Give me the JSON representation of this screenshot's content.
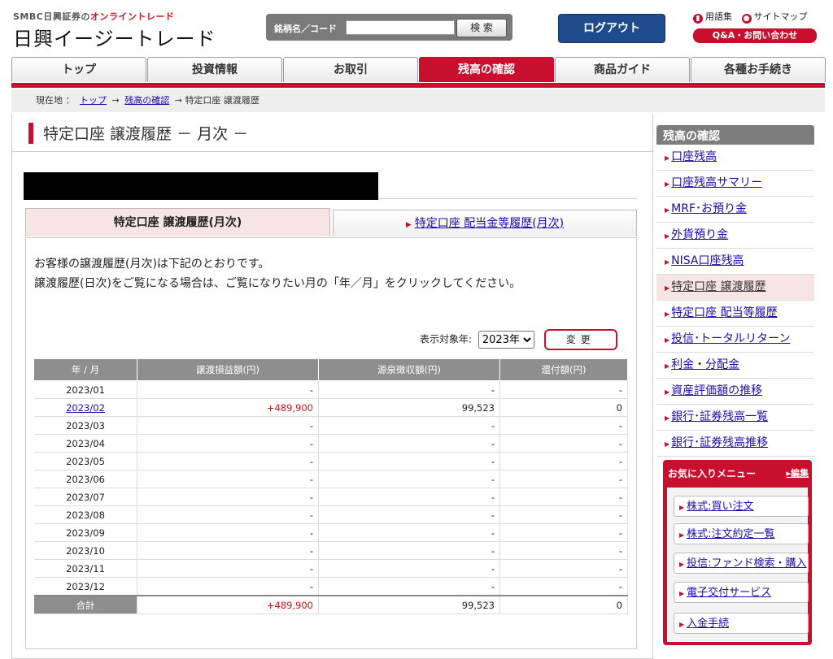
{
  "header": {
    "brand_prefix": "SMBC日興証券の",
    "brand_highlight": "オンライントレード",
    "brand_main": "日興イージートレード",
    "search_label": "銘柄名／コード",
    "search_value": "",
    "search_button": "検 索",
    "logout": "ログアウト",
    "glossary": "用語集",
    "sitemap": "サイトマップ",
    "qa": "Q&A・お問い合わせ"
  },
  "nav": {
    "tabs": [
      "トップ",
      "投資情報",
      "お取引",
      "残高の確認",
      "商品ガイド",
      "各種お手続き"
    ],
    "active": "残高の確認"
  },
  "breadcrumb": {
    "label": "現在地 ：",
    "top": "トップ",
    "sep1": "→",
    "balance": "残高の確認",
    "sep2": "→",
    "current": "特定口座 譲渡履歴"
  },
  "page": {
    "title": "特定口座 譲渡履歴 － 月次 －",
    "tab_active": "特定口座 譲渡履歴(月次)",
    "tab_other": "特定口座 配当金等履歴(月次)",
    "intro1": "お客様の譲渡履歴(月次)は下記のとおりです。",
    "intro2": "譲渡履歴(日次)をご覧になる場合は、ご覧になりたい月の「年／月」をクリックしてください。",
    "year_label": "表示対象年:",
    "year_value": "2023年",
    "change_button": "変更"
  },
  "table": {
    "headers": [
      "年 / 月",
      "譲渡損益額(円)",
      "源泉徴収額(円)",
      "還付額(円)"
    ],
    "rows": [
      {
        "month": "2023/01",
        "gain": "-",
        "tax": "-",
        "refund": "-",
        "link": false
      },
      {
        "month": "2023/02",
        "gain": "+489,900",
        "tax": "99,523",
        "refund": "0",
        "link": true
      },
      {
        "month": "2023/03",
        "gain": "-",
        "tax": "-",
        "refund": "-",
        "link": false
      },
      {
        "month": "2023/04",
        "gain": "-",
        "tax": "-",
        "refund": "-",
        "link": false
      },
      {
        "month": "2023/05",
        "gain": "-",
        "tax": "-",
        "refund": "-",
        "link": false
      },
      {
        "month": "2023/06",
        "gain": "-",
        "tax": "-",
        "refund": "-",
        "link": false
      },
      {
        "month": "2023/07",
        "gain": "-",
        "tax": "-",
        "refund": "-",
        "link": false
      },
      {
        "month": "2023/08",
        "gain": "-",
        "tax": "-",
        "refund": "-",
        "link": false
      },
      {
        "month": "2023/09",
        "gain": "-",
        "tax": "-",
        "refund": "-",
        "link": false
      },
      {
        "month": "2023/10",
        "gain": "-",
        "tax": "-",
        "refund": "-",
        "link": false
      },
      {
        "month": "2023/11",
        "gain": "-",
        "tax": "-",
        "refund": "-",
        "link": false
      },
      {
        "month": "2023/12",
        "gain": "-",
        "tax": "-",
        "refund": "-",
        "link": false
      }
    ],
    "total_label": "合計",
    "total_gain": "+489,900",
    "total_tax": "99,523",
    "total_refund": "0"
  },
  "sidebar": {
    "title": "残高の確認",
    "items": [
      "口座残高",
      "口座残高サマリー",
      "MRF･お預り金",
      "外貨預り金",
      "NISA口座残高",
      "特定口座 譲渡履歴",
      "特定口座 配当等履歴",
      "投信･トータルリターン",
      "利金・分配金",
      "資産評価額の推移",
      "銀行･証券残高一覧",
      "銀行･証券残高推移"
    ],
    "active": "特定口座 譲渡履歴"
  },
  "favorites": {
    "title": "お気に入りメニュー",
    "edit": "編集",
    "items": [
      "株式:買い注文",
      "株式:注文約定一覧",
      "投信:ファンド検索・購入",
      "電子交付サービス",
      "入金手続"
    ]
  },
  "colors": {
    "accent": "#c8102e",
    "header_gray": "#8e8e8e",
    "logout_blue": "#1f4a8c"
  }
}
